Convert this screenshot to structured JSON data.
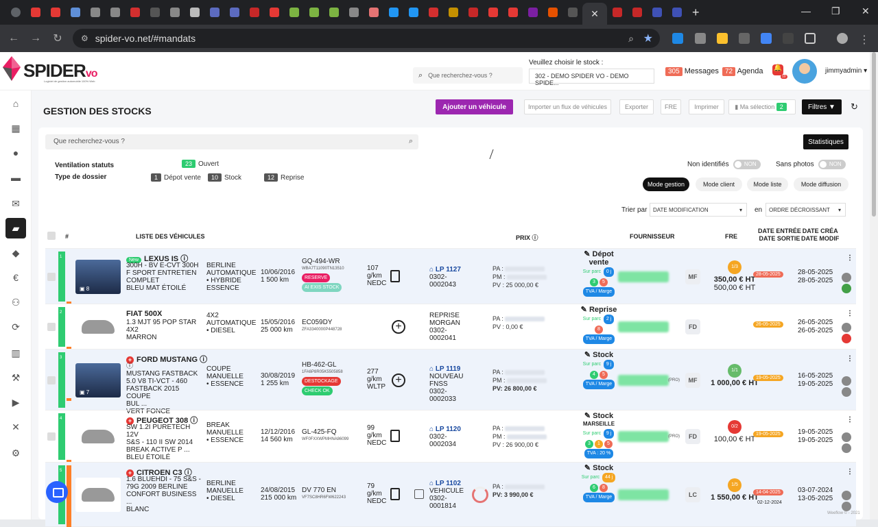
{
  "browser": {
    "url": "spider-vo.net/#mandats",
    "tab_colors": [
      "#e53935",
      "#e53935",
      "#5f8fd8",
      "#888",
      "#888",
      "#d32f2f",
      "#555",
      "#888",
      "#bbb",
      "#5c6bc0",
      "#5c6bc0",
      "#c62828",
      "#e53935",
      "#7cb342",
      "#7cb342",
      "#7cb342",
      "#888",
      "#e57373",
      "#2196f3",
      "#2196f3",
      "#d32f2f",
      "#c49000",
      "#c62828",
      "#e53935",
      "#e53935",
      "#7b1fa2",
      "#e65100",
      "#555",
      "#c62828",
      "#c62828",
      "#3f51b5",
      "#3f51b5"
    ]
  },
  "header": {
    "search_placeholder": "Que recherchez-vous ?",
    "stock_label": "Veuillez choisir le stock :",
    "stock_value": "302 - DEMO SPIDER VO - DEMO SPIDE...",
    "messages_count": "305",
    "messages_label": "Messages",
    "agenda_count": "72",
    "agenda_label": "Agenda",
    "bell_count": "10",
    "user": "jimmyadmin",
    "logo_main": "SPIDER",
    "logo_vo": "vo",
    "logo_tag": "Logiciel de gestion automobile 100% Web"
  },
  "page": {
    "title": "GESTION DES STOCKS",
    "btn_add": "Ajouter un véhicule",
    "btn_import": "Importer un flux de véhicules",
    "btn_export": "Exporter",
    "btn_fre": "FRE",
    "btn_print": "Imprimer",
    "btn_selection": "Ma sélection",
    "selection_count": "2",
    "btn_filters": "Filtres",
    "search_placeholder": "Que recherchez-vous ?",
    "btn_stats": "Statistiques",
    "ventilation_label": "Ventilation statuts",
    "type_label": "Type de dossier",
    "ouvert_count": "23",
    "ouvert_label": "Ouvert",
    "depot_count": "1",
    "depot_label": "Dépot vente",
    "stock_count": "10",
    "stock_label": "Stock",
    "reprise_count": "12",
    "reprise_label": "Reprise",
    "non_identifies": "Non identifiés",
    "sans_photos": "Sans photos",
    "toggle_non": "NON",
    "modes": [
      "Mode gestion",
      "Mode client",
      "Mode liste",
      "Mode diffusion"
    ],
    "trier_par": "Trier par",
    "sort_field": "DATE MODIFICATION",
    "en": "en",
    "sort_order": "ORDRE DÉCROISSANT",
    "th": {
      "num": "#",
      "list": "LISTE DES VÉHICULES",
      "prix": "PRIX",
      "four": "FOURNISSEUR",
      "fre": "FRE",
      "de1": "DATE ENTRÉE",
      "de2": "DATE SORTIE",
      "dc1": "DATE CRÉA",
      "dc2": "DATE MODIF"
    }
  },
  "rows": [
    {
      "num": "1",
      "photos": "8",
      "is_new": "New",
      "title": "LEXUS IS",
      "desc": [
        "300H - BV E-CVT 300H",
        "F SPORT ENTRETIEN",
        "COMPLET",
        "BLEU MAT ÉTOILÉ"
      ],
      "body": [
        "BERLINE",
        "AUTOMATIQUE",
        "• HYBRIDE",
        "ESSENCE"
      ],
      "date": [
        "10/06/2016",
        "1 500 km"
      ],
      "plate": "GQ-494-WR",
      "vin": "WBA7T11090TN13510",
      "pills": [
        {
          "t": "RESERVE",
          "c": "#e91e63"
        },
        {
          "t": "AI EXIS STOCK",
          "c": "#7fd6c0"
        }
      ],
      "co2": [
        "107",
        "g/km",
        "NEDC"
      ],
      "lp": "LP 1127",
      "lp_sub": [
        "0302-",
        "0002043"
      ],
      "pa": "PA :",
      "pm": "PM :",
      "pv": "PV : 25 000,00 €",
      "type": "Dépot",
      "type2": "vente",
      "parc": "Sur parc",
      "parc_val": "0 j",
      "dots": [
        {
          "t": "3",
          "c": "#2ecc71"
        },
        {
          "t": "5",
          "c": "#ef6c57"
        }
      ],
      "tva": "TVA / Marge",
      "init": "MF",
      "fre_badge": "1/3",
      "fre_color": "#f5a623",
      "fre1": "350,00 € HT",
      "fre2": "500,00 € HT",
      "rdate": "28-05-2025",
      "rdate_c": "#ef6c57",
      "dates": [
        "28-05-2025",
        "28-05-2025"
      ]
    },
    {
      "num": "2",
      "photos": "",
      "is_new": "",
      "title": "FIAT 500X",
      "desc": [
        "1.3 MJT 95 POP STAR",
        "4X2",
        "MARRON",
        ""
      ],
      "body": [
        "4X2",
        "AUTOMATIQUE",
        "• DIESEL",
        ""
      ],
      "date": [
        "15/05/2016",
        "25 000 km"
      ],
      "plate": "EC059DY",
      "vin": "ZFA3340000P448728",
      "pills": [],
      "co2": [
        "",
        "",
        ""
      ],
      "lp": "",
      "lp_sub": [
        "REPRISE",
        "MORGAN",
        "0302-",
        "0002041"
      ],
      "pa": "PA :",
      "pm": "",
      "pv": "PV : 0,00 €",
      "type": "Reprise",
      "type2": "",
      "parc": "Sur parc",
      "parc_val": "2 j",
      "dots": [
        {
          "t": "8",
          "c": "#ef6c57"
        }
      ],
      "tva": "TVA / Marge",
      "init": "FD",
      "fre_badge": "",
      "fre_color": "",
      "fre1": "",
      "fre2": "",
      "rdate": "26-05-2025",
      "rdate_c": "#f5a623",
      "dates": [
        "26-05-2025",
        "26-05-2025"
      ]
    },
    {
      "num": "3",
      "photos": "7",
      "is_new": "",
      "title": "FORD MUSTANG",
      "desc": [
        "MUSTANG FASTBACK",
        "5.0 V8 TI-VCT - 460",
        "FASTBACK 2015 COUPE",
        "BUL ...",
        "VERT FONCE"
      ],
      "body": [
        "COUPE",
        "MANUELLE",
        "• ESSENCE",
        ""
      ],
      "date": [
        "30/08/2019",
        "1 255 km"
      ],
      "plate": "HB-462-GL",
      "vin": "1FA6P8R05K5505858",
      "pills": [
        {
          "t": "DESTOCKAGE",
          "c": "#e53935"
        },
        {
          "t": "CHECK OK",
          "c": "#2ecc71"
        }
      ],
      "co2": [
        "277",
        "g/km",
        "WLTP"
      ],
      "lp": "LP 1119",
      "lp_sub": [
        "NOUVEAU",
        "FNSS",
        "0302-",
        "0002033"
      ],
      "pa": "PA :",
      "pm": "PM :",
      "pv": "PV: 26 800,00 €",
      "type": "Stock",
      "type2": "",
      "parc": "Sur parc",
      "parc_val": "9 j",
      "dots": [
        {
          "t": "4",
          "c": "#2ecc71"
        },
        {
          "t": "5",
          "c": "#ef6c57"
        }
      ],
      "tva": "TVA / Marge",
      "init": "MF",
      "fre_badge": "1/1",
      "fre_color": "#66bb6a",
      "fre1": "1 000,00 € HT",
      "fre2": "",
      "rdate": "19-05-2025",
      "rdate_c": "#f5a623",
      "dates": [
        "16-05-2025",
        "19-05-2025"
      ]
    },
    {
      "num": "4",
      "photos": "",
      "is_new": "",
      "title": "PEUGEOT 308",
      "desc": [
        "SW 1.2I PURETECH 12V",
        "S&S - 110 II SW 2014",
        "BREAK ACTIVE P ...",
        "BLEU ÉTOILÉ"
      ],
      "body": [
        "BREAK",
        "MANUELLE",
        "• ESSENCE",
        ""
      ],
      "date": [
        "12/12/2016",
        "14 560 km"
      ],
      "plate": "GL-425-FQ",
      "vin": "WF0FXXWPMHNA86099",
      "pills": [],
      "co2": [
        "99",
        "g/km",
        "NEDC"
      ],
      "lp": "LP 1120",
      "lp_sub": [
        "0302-",
        "0002034"
      ],
      "pa": "PA :",
      "pm": "PM :",
      "pv": "PV : 26 900,00 €",
      "type": "Stock",
      "type2": "MARSEILLE",
      "parc": "Sur parc",
      "parc_val": "9 j",
      "dots": [
        {
          "t": "3",
          "c": "#2ecc71"
        },
        {
          "t": "1",
          "c": "#f5a623"
        },
        {
          "t": "5",
          "c": "#ef6c57"
        }
      ],
      "tva": "TVA : 20 %",
      "init": "FD",
      "fre_badge": "0/2",
      "fre_color": "#e53935",
      "fre1": "100,00 € HT",
      "fre2": "",
      "rdate": "19-05-2025",
      "rdate_c": "#f5a623",
      "dates": [
        "19-05-2025",
        "19-05-2025"
      ]
    },
    {
      "num": "5",
      "photos": "",
      "is_new": "",
      "title": "CITROEN C3",
      "desc": [
        "1.6 BLUEHDI - 75 S&S -",
        "79G 2009 BERLINE",
        "CONFORT BUSINESS ...",
        "BLANC"
      ],
      "body": [
        "BERLINE",
        "MANUELLE",
        "• DIESEL",
        ""
      ],
      "date": [
        "24/08/2015",
        "215 000 km"
      ],
      "plate": "DV 770 EN",
      "vin": "VF7SC8HR6FW622243",
      "pills": [],
      "co2": [
        "79",
        "g/km",
        "NEDC"
      ],
      "lp": "LP 1102",
      "lp_sub": [
        "VEHICULE",
        "0302-",
        "0001814"
      ],
      "pa": "PA :",
      "pm": "",
      "pv": "PV: 3 990,00 €",
      "type": "Stock",
      "type2": "",
      "parc": "Sur parc",
      "parc_val": "44 j",
      "dots": [
        {
          "t": "6",
          "c": "#2ecc71"
        },
        {
          "t": "8",
          "c": "#ef6c57"
        }
      ],
      "tva": "TVA / Marge",
      "init": "LC",
      "fre_badge": "1/5",
      "fre_color": "#f5a623",
      "fre1": "1 550,00 € HT",
      "fre2": "",
      "rdate": "14-04-2025",
      "rdate_c": "#ef6c57",
      "rdate2": "02-12-2024",
      "dates": [
        "03-07-2024",
        "13-05-2025"
      ]
    }
  ],
  "footer": {
    "weeflow": "Weeflow © - 2021"
  }
}
